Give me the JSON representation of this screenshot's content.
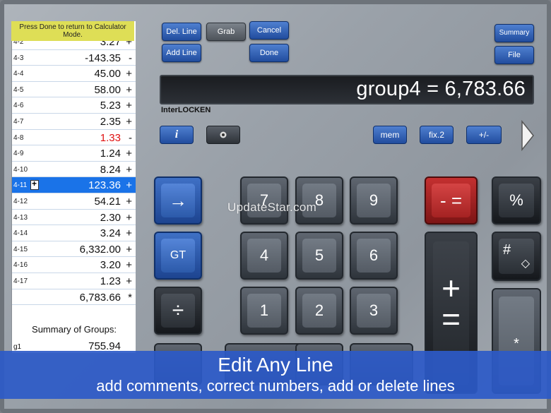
{
  "tape": {
    "banner": "Press Done to return to Calculator Mode.",
    "rows": [
      {
        "label": "4-2",
        "value": "3.27",
        "op": "+"
      },
      {
        "label": "4-3",
        "value": "-143.35",
        "op": "-"
      },
      {
        "label": "4-4",
        "value": "45.00",
        "op": "+"
      },
      {
        "label": "4-5",
        "value": "58.00",
        "op": "+"
      },
      {
        "label": "4-6",
        "value": "5.23",
        "op": "+"
      },
      {
        "label": "4-7",
        "value": "2.35",
        "op": "+"
      },
      {
        "label": "4-8",
        "value": "1.33",
        "op": "-"
      },
      {
        "label": "4-9",
        "value": "1.24",
        "op": "+"
      },
      {
        "label": "4-10",
        "value": "8.24",
        "op": "+"
      },
      {
        "label": "4-11",
        "value": "123.36",
        "op": "+"
      },
      {
        "label": "4-12",
        "value": "54.21",
        "op": "+"
      },
      {
        "label": "4-13",
        "value": "2.30",
        "op": "+"
      },
      {
        "label": "4-14",
        "value": "3.24",
        "op": "+"
      },
      {
        "label": "4-15",
        "value": "6,332.00",
        "op": "+"
      },
      {
        "label": "4-16",
        "value": "3.20",
        "op": "+"
      },
      {
        "label": "4-17",
        "value": "1.23",
        "op": "+"
      },
      {
        "label": "",
        "value": "6,783.66",
        "op": "*"
      }
    ],
    "summary_title": "Summary of Groups:",
    "group_label": "g1",
    "group_value": "755.94"
  },
  "top_buttons": {
    "del_line": "Del. Line",
    "grab": "Grab",
    "cancel": "Cancel",
    "add_line": "Add Line",
    "done": "Done",
    "summary": "Summary",
    "file": "File"
  },
  "display": {
    "text": "group4 = 6,783.66",
    "brand": "InterLOCKEN"
  },
  "function_row": {
    "mem": "mem",
    "fix": "fix.2",
    "sign": "+/-",
    "info_icon": "info-icon",
    "settings_icon": "gear-icon"
  },
  "keys": {
    "k7": "7",
    "k8": "8",
    "k9": "9",
    "k4": "4",
    "k5": "5",
    "k6": "6",
    "k1": "1",
    "k2": "2",
    "k3": "3",
    "gt": "GT",
    "minus_eq": "- =",
    "percent": "%",
    "hash": "#",
    "hash_sub": "◇",
    "divide": "÷",
    "plus": "+",
    "eq": "=",
    "star": "*",
    "arrow": "→"
  },
  "watermark": "UpdateStar.com",
  "caption": {
    "title": "Edit Any Line",
    "subtitle": "add comments, correct numbers, add or delete lines"
  },
  "colors": {
    "accent_blue": "#2d5ac8",
    "selected_row": "#1a73e8",
    "banner_yellow": "#dede56",
    "negative_red": "#e01010",
    "key_red": "#c43030"
  }
}
